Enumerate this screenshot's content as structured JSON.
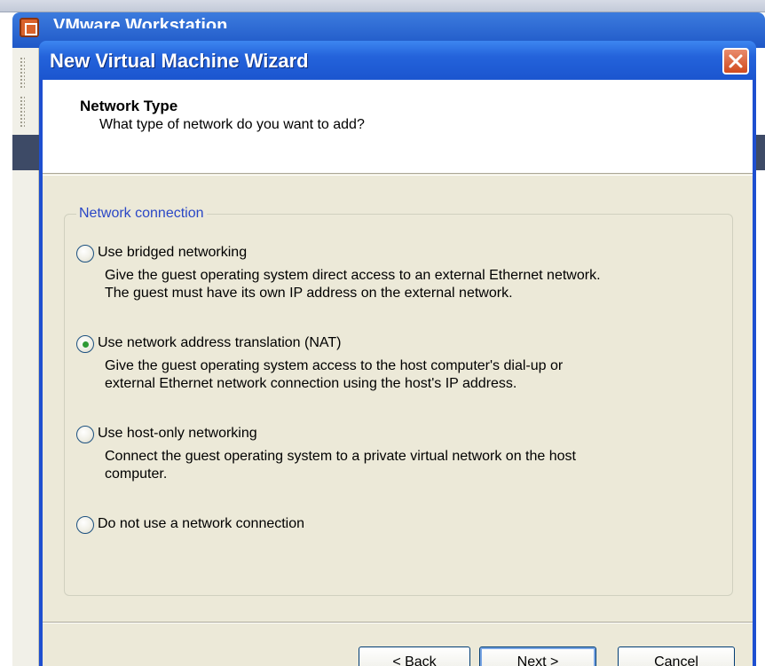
{
  "background_app": {
    "title": "VMware Workstation"
  },
  "dialog": {
    "title": "New Virtual Machine Wizard",
    "close_icon": "close-x-icon"
  },
  "header": {
    "title": "Network Type",
    "subtitle": "What type of network do you want to add?"
  },
  "group": {
    "legend": "Network connection"
  },
  "options": [
    {
      "label": "Use bridged networking",
      "checked": false,
      "desc": [
        "Give the guest operating system direct access to an external Ethernet network.",
        "The guest must have its own IP address on the external network."
      ]
    },
    {
      "label": "Use network address translation (NAT)",
      "checked": true,
      "desc": [
        "Give the guest operating system access to the host computer's dial-up or",
        "external Ethernet network connection using the host's IP address."
      ]
    },
    {
      "label": "Use host-only networking",
      "checked": false,
      "desc": [
        "Connect the guest operating system to a private virtual network on the host",
        "computer."
      ]
    },
    {
      "label": "Do not use a network connection",
      "checked": false,
      "desc": []
    }
  ],
  "buttons": {
    "back": "< Back",
    "next": "Next >",
    "cancel": "Cancel"
  },
  "colors": {
    "titlebar": "#2463db",
    "dialog_bg": "#ece9d8",
    "legend_text": "#2a47c6",
    "radio_selected": "#2f9a35",
    "close_button": "#d14a1e"
  }
}
